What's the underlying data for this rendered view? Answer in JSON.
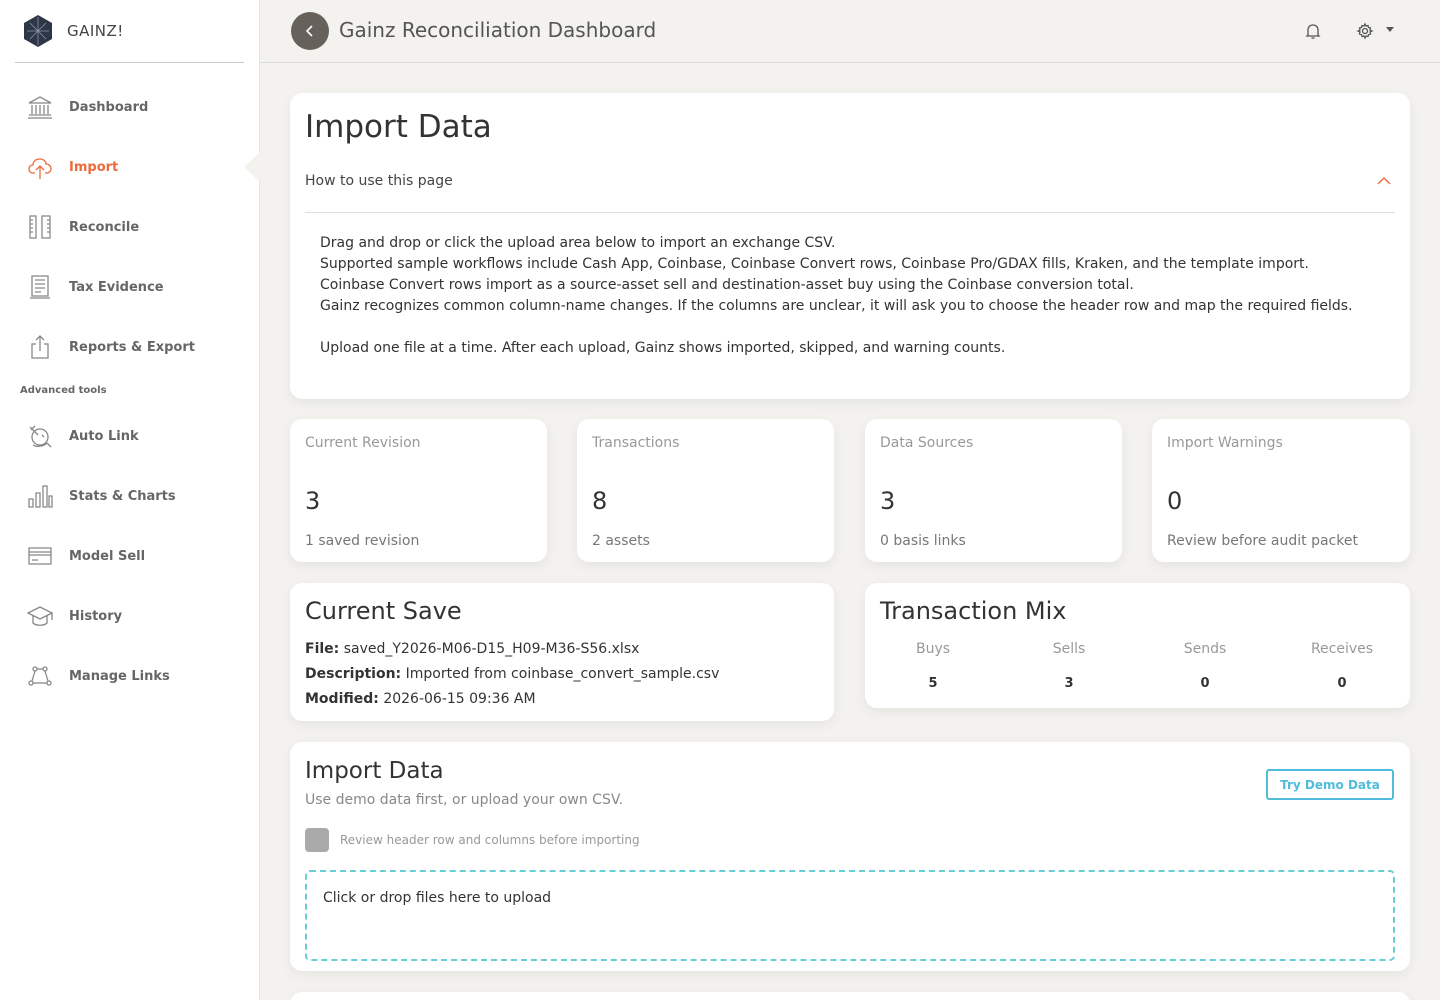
{
  "app": {
    "name": "GAINZ!"
  },
  "header": {
    "title": "Gainz Reconciliation Dashboard"
  },
  "sidebar": {
    "items": [
      {
        "label": "Dashboard",
        "icon": "bank-icon",
        "active": false
      },
      {
        "label": "Import",
        "icon": "cloud-upload-icon",
        "active": true
      },
      {
        "label": "Reconcile",
        "icon": "ruler-icon",
        "active": false
      },
      {
        "label": "Tax Evidence",
        "icon": "document-icon",
        "active": false
      },
      {
        "label": "Reports & Export",
        "icon": "share-icon",
        "active": false
      }
    ],
    "section_label": "Advanced tools",
    "advanced_items": [
      {
        "label": "Auto Link",
        "icon": "satellite-icon"
      },
      {
        "label": "Stats & Charts",
        "icon": "bar-chart-icon"
      },
      {
        "label": "Model Sell",
        "icon": "credit-card-icon"
      },
      {
        "label": "History",
        "icon": "graduation-cap-icon"
      },
      {
        "label": "Manage Links",
        "icon": "network-icon"
      }
    ]
  },
  "import_intro": {
    "title": "Import Data",
    "howto_label": "How to use this page",
    "lines": [
      "Drag and drop or click the upload area below to import an exchange CSV.",
      "Supported sample workflows include Cash App, Coinbase, Coinbase Convert rows, Coinbase Pro/GDAX fills, Kraken, and the template import.",
      "Coinbase Convert rows import as a source-asset sell and destination-asset buy using the Coinbase conversion total.",
      "Gainz recognizes common column-name changes. If the columns are unclear, it will ask you to choose the header row and map the required fields.",
      "Upload one file at a time. After each upload, Gainz shows imported, skipped, and warning counts."
    ]
  },
  "stats": [
    {
      "label": "Current Revision",
      "value": "3",
      "sub": "1 saved revision"
    },
    {
      "label": "Transactions",
      "value": "8",
      "sub": "2 assets"
    },
    {
      "label": "Data Sources",
      "value": "3",
      "sub": "0 basis links"
    },
    {
      "label": "Import Warnings",
      "value": "0",
      "sub": "Review before audit packet"
    }
  ],
  "current_save": {
    "title": "Current Save",
    "file_label": "File:",
    "file_value": "saved_Y2026-M06-D15_H09-M36-S56.xlsx",
    "description_label": "Description:",
    "description_value": "Imported from coinbase_convert_sample.csv",
    "modified_label": "Modified:",
    "modified_value": "2026-06-15 09:36 AM"
  },
  "transaction_mix": {
    "title": "Transaction Mix",
    "columns": [
      {
        "label": "Buys",
        "value": "5"
      },
      {
        "label": "Sells",
        "value": "3"
      },
      {
        "label": "Sends",
        "value": "0"
      },
      {
        "label": "Receives",
        "value": "0"
      }
    ]
  },
  "upload": {
    "title": "Import Data",
    "subtitle": "Use demo data first, or upload your own CSV.",
    "demo_button": "Try Demo Data",
    "checkbox_label": "Review header row and columns before importing",
    "checkbox_checked": false,
    "dropzone_text": "Click or drop files here to upload"
  },
  "colors": {
    "accent": "#ec6b3e",
    "info": "#51bcda",
    "dropzone_border": "#66cfd6",
    "background": "#f3f2ee"
  }
}
